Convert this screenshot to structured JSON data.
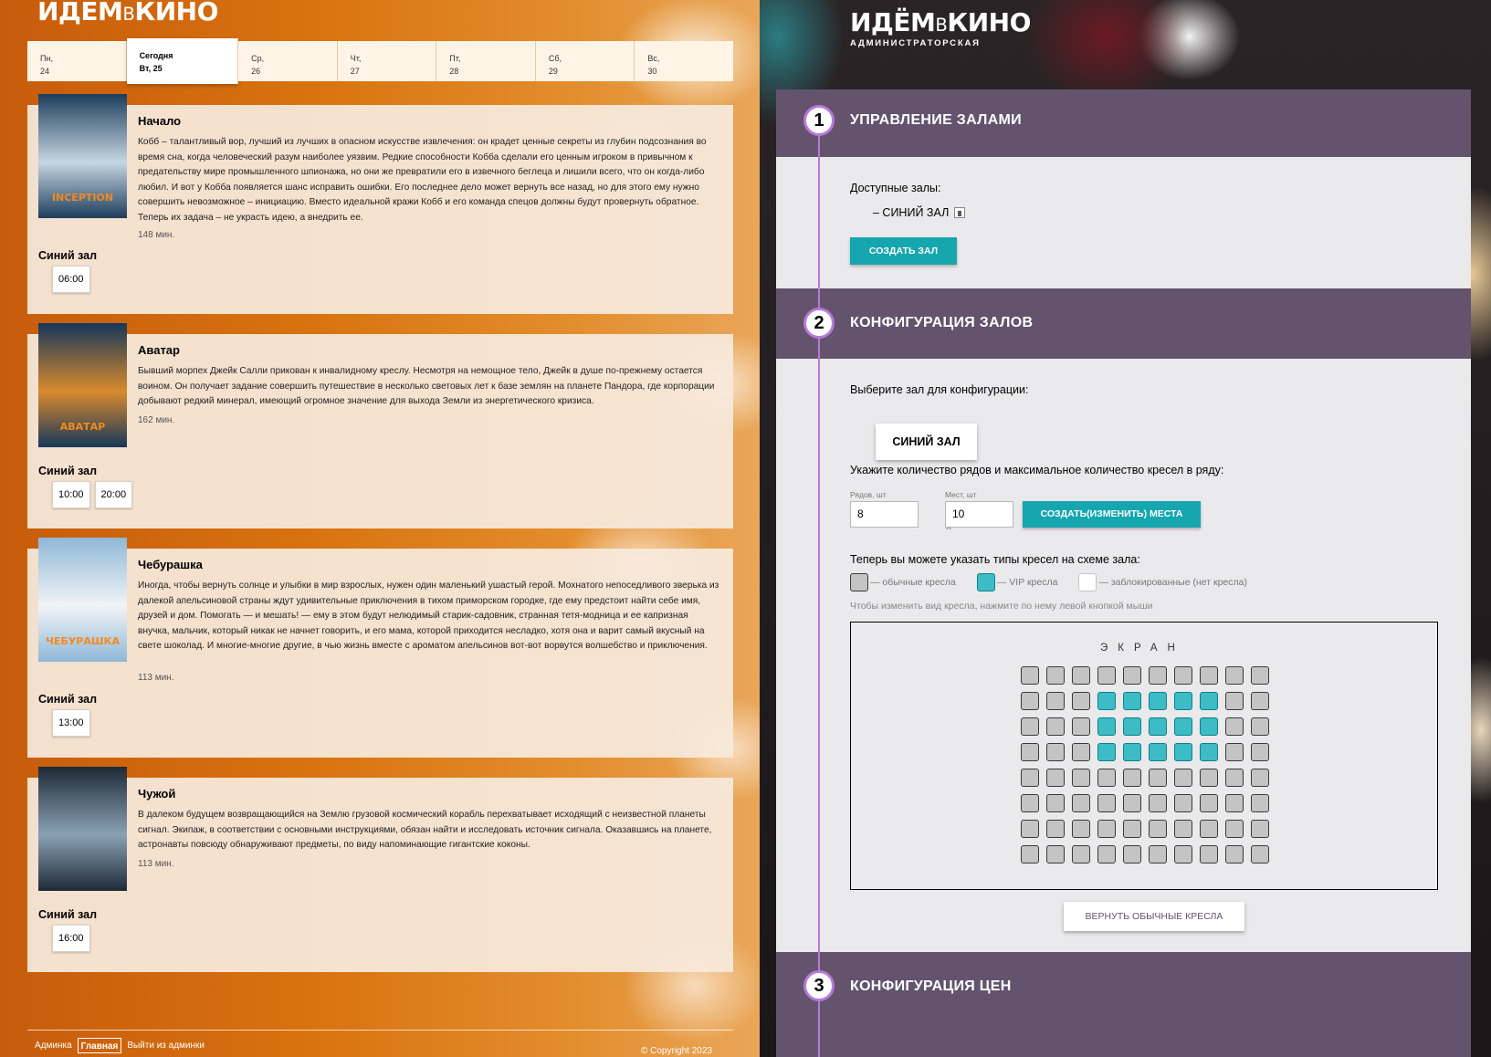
{
  "client": {
    "logo": {
      "part1": "ИДЁМ",
      "part2": "В",
      "part3": "КИНО"
    },
    "days": [
      {
        "weekday": "Пн,",
        "date": "24",
        "today": false
      },
      {
        "weekday": "Сегодня",
        "date": "Вт, 25",
        "today": true
      },
      {
        "weekday": "Ср,",
        "date": "26",
        "today": false
      },
      {
        "weekday": "Чт,",
        "date": "27",
        "today": false
      },
      {
        "weekday": "Пт,",
        "date": "28",
        "today": false
      },
      {
        "weekday": "Сб,",
        "date": "29",
        "today": false
      },
      {
        "weekday": "Вс,",
        "date": "30",
        "today": false
      }
    ],
    "movies": [
      {
        "title": "Начало",
        "description": "Кобб – талантливый вор, лучший из лучших в опасном искусстве извлечения: он крадет ценные секреты из глубин подсознания во время сна, когда человеческий разум наиболее уязвим. Редкие способности Кобба сделали его ценным игроком в привычном к предательству мире промышленного шпионажа, но они же превратили его в извечного беглеца и лишили всего, что он когда-либо любил. И вот у Кобба появляется шанс исправить ошибки. Его последнее дело может вернуть все назад, но для этого ему нужно совершить невозможное – инициацию. Вместо идеальной кражи Кобб и его команда спецов должны будут провернуть обратное. Теперь их задача – не украсть идею, а внедрить ее.",
        "duration": "148 мин.",
        "hall": "Синий зал",
        "times": [
          "06:00"
        ],
        "poster_caption": "INCEPTION",
        "poster_colors": [
          "#1d3d5c",
          "#c7d6e2"
        ]
      },
      {
        "title": "Аватар",
        "description": "Бывший морпех Джейк Салли прикован к инвалидному креслу. Несмотря на немощное тело, Джейк в душе по-прежнему остается воином. Он получает задание совершить путешествие в несколько световых лет к базе землян на планете Пандора, где корпорации добывают редкий минерал, имеющий огромное значение для выхода Земли из энергетического кризиса.",
        "duration": "162 мин.",
        "hall": "Синий зал",
        "times": [
          "10:00",
          "20:00"
        ],
        "poster_caption": "АВАТАР",
        "poster_colors": [
          "#16375a",
          "#d98a2e"
        ]
      },
      {
        "title": "Чебурашка",
        "description": "Иногда, чтобы вернуть солнце и улыбки в мир взрослых, нужен один маленький ушастый герой. Мохнатого непоседливого зверька из далекой апельсиновой страны ждут удивительные приключения в тихом приморском городке, где ему предстоит найти себе имя, друзей и дом. Помогать — и мешать! — ему в этом будут нелюдимый старик-садовник, странная тетя-модница и ее капризная внучка, мальчик, который никак не начнет говорить, и его мама, которой приходится несладко, хотя она и варит самый вкусный на свете шоколад. И многие-многие другие, в чью жизнь вместе с ароматом апельсинов вот-вот ворвутся волшебство и приключения.",
        "duration": "113 мин.",
        "hall": "Синий зал",
        "times": [
          "13:00"
        ],
        "poster_caption": "ЧЕБУРАШКА",
        "poster_colors": [
          "#8fb8d8",
          "#f2f4f6"
        ]
      },
      {
        "title": "Чужой",
        "description": "В далеком будущем возвращающийся на Землю грузовой космический корабль перехватывает исходящий с неизвестной планеты сигнал. Экипаж, в соответствии с основными инструкциями, обязан найти и исследовать источник сигнала. Оказавшись на планете, астронавты повсюду обнаруживают предметы, по виду напоминающие гигантские коконы.",
        "duration": "113 мин.",
        "hall": "Синий зал",
        "times": [
          "16:00"
        ],
        "poster_caption": "",
        "poster_colors": [
          "#1e2a36",
          "#8aa1b5"
        ]
      }
    ],
    "footer": {
      "links": [
        "Админка",
        "Главная",
        "Выйти из админки"
      ],
      "active_link": "Главная",
      "copyright": "© Copyright 2023"
    }
  },
  "admin": {
    "logo_sub": "Администраторская",
    "sections": [
      {
        "num": "1",
        "title": "Управление залами"
      },
      {
        "num": "2",
        "title": "Конфигурация залов"
      },
      {
        "num": "3",
        "title": "Конфигурация цен"
      }
    ],
    "halls_label": "Доступные залы:",
    "halls": [
      "– СИНИЙ ЗАЛ"
    ],
    "create_hall": "Создать зал",
    "select_hall_label": "Выберите зал для конфигурации:",
    "selected_hall": "Синий зал",
    "rows_seats_label": "Укажите количество рядов и максимальное количество кресел в ряду:",
    "rows_label": "Рядов, шт",
    "rows_value": "8",
    "seats_label": "Мест, шт",
    "seats_value": "10",
    "times_sign": "x",
    "create_seats": "Создать(изменить) места",
    "types_label": "Теперь вы можете указать типы кресел на схеме зала:",
    "legend": [
      {
        "type": "std",
        "label": "— обычные кресла"
      },
      {
        "type": "vip",
        "label": "— VIP кресла"
      },
      {
        "type": "blk",
        "label": "— заблокированные (нет кресла)"
      }
    ],
    "hint": "Чтобы изменить вид кресла, нажмите по нему левой кнопкой мыши",
    "screen_label": "ЭКРАН",
    "seat_map": [
      [
        "s",
        "s",
        "s",
        "s",
        "s",
        "s",
        "s",
        "s",
        "s",
        "s"
      ],
      [
        "s",
        "s",
        "s",
        "v",
        "v",
        "v",
        "v",
        "v",
        "s",
        "s"
      ],
      [
        "s",
        "s",
        "s",
        "v",
        "v",
        "v",
        "v",
        "v",
        "s",
        "s"
      ],
      [
        "s",
        "s",
        "s",
        "v",
        "v",
        "v",
        "v",
        "v",
        "s",
        "s"
      ],
      [
        "s",
        "s",
        "s",
        "s",
        "s",
        "s",
        "s",
        "s",
        "s",
        "s"
      ],
      [
        "s",
        "s",
        "s",
        "s",
        "s",
        "s",
        "s",
        "s",
        "s",
        "s"
      ],
      [
        "s",
        "s",
        "s",
        "s",
        "s",
        "s",
        "s",
        "s",
        "s",
        "s"
      ],
      [
        "s",
        "s",
        "s",
        "s",
        "s",
        "s",
        "s",
        "s",
        "s",
        "s"
      ]
    ],
    "reset_button": "Вернуть обычные кресла"
  },
  "colors": {
    "accent": "#16a6af",
    "admin_header": "#63536c",
    "vip_seat": "#3dbcc5",
    "std_seat": "#c4c4c4",
    "timeline": "#b77ad8"
  }
}
